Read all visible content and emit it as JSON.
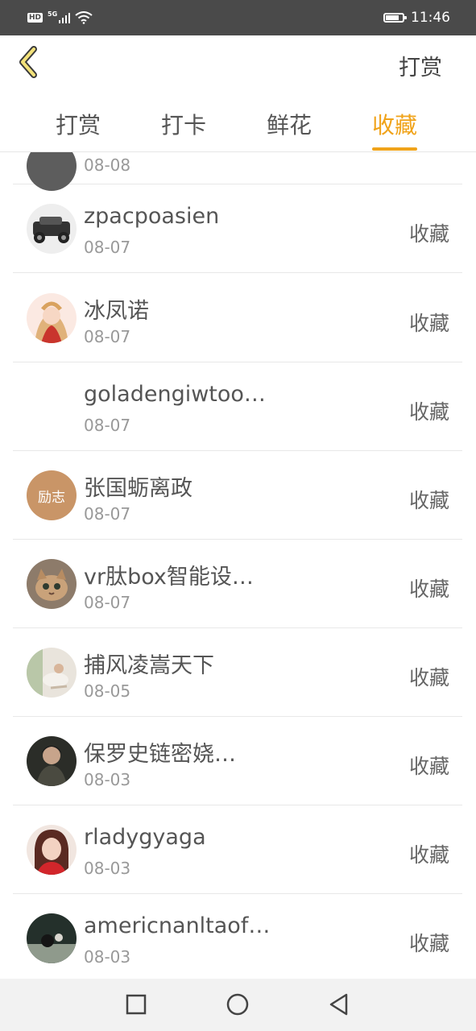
{
  "status_bar": {
    "hd": "HD",
    "network": "5G",
    "battery_level": 0.8,
    "time": "11:46"
  },
  "header": {
    "back_icon": "chevron-left-icon",
    "action_label": "打赏",
    "accent": "#f0a31a"
  },
  "tabs": [
    {
      "label": "打赏",
      "active": false
    },
    {
      "label": "打卡",
      "active": false
    },
    {
      "label": "鲜花",
      "active": false
    },
    {
      "label": "收藏",
      "active": true
    }
  ],
  "list": {
    "partial_item": {
      "date": "08-08"
    },
    "items": [
      {
        "name": "zpacpoasien",
        "date": "08-07",
        "action": "收藏",
        "avatar": "car"
      },
      {
        "name": "冰凤诺",
        "date": "08-07",
        "action": "收藏",
        "avatar": "anime-girl"
      },
      {
        "name": "goladengiwtoo…",
        "date": "08-07",
        "action": "收藏",
        "avatar": "none"
      },
      {
        "name": "张国蛎离政",
        "date": "08-07",
        "action": "收藏",
        "avatar": "text-badge",
        "avatar_text": "励志"
      },
      {
        "name": "vr肽box智能设…",
        "date": "08-07",
        "action": "收藏",
        "avatar": "kitten"
      },
      {
        "name": "捕风凌嵩天下",
        "date": "08-05",
        "action": "收藏",
        "avatar": "photo-light"
      },
      {
        "name": "保罗史链密娆…",
        "date": "08-03",
        "action": "收藏",
        "avatar": "child"
      },
      {
        "name": "rladygyaga",
        "date": "08-03",
        "action": "收藏",
        "avatar": "woman"
      },
      {
        "name": "americnanltaof…",
        "date": "08-03",
        "action": "收藏",
        "avatar": "dark-photo"
      }
    ]
  },
  "nav_bar": {
    "recent_icon": "square-icon",
    "home_icon": "circle-icon",
    "back_icon": "triangle-back-icon"
  }
}
